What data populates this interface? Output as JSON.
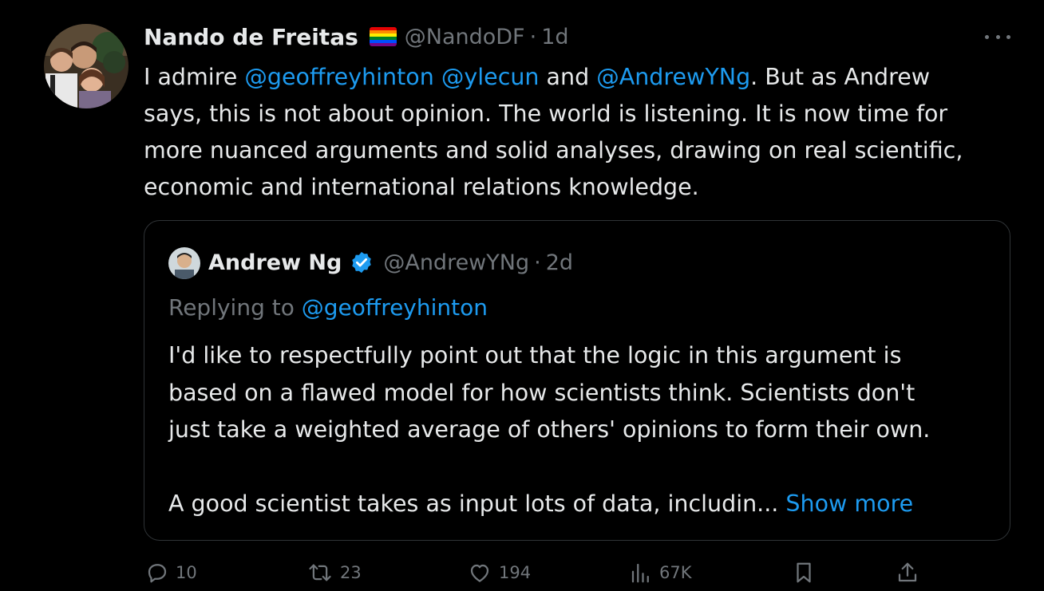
{
  "tweet": {
    "display_name": "Nando de Freitas",
    "handle": "@NandoDF",
    "separator": "·",
    "time": "1d",
    "flag_icon": "rainbow-flag-icon",
    "text_lines": [
      {
        "parts": [
          {
            "text": "I admire ",
            "mention": false
          },
          {
            "text": "@geoffreyhinton",
            "mention": true
          },
          {
            "text": " ",
            "mention": false
          },
          {
            "text": "@ylecun",
            "mention": true
          },
          {
            "text": " and ",
            "mention": false
          },
          {
            "text": "@AndrewYNg",
            "mention": true
          },
          {
            "text": ". But as Andrew",
            "mention": false
          }
        ]
      },
      {
        "parts": [
          {
            "text": "says, this is not about opinion. The world is listening. It is now time for",
            "mention": false
          }
        ]
      },
      {
        "parts": [
          {
            "text": "more nuanced arguments and solid analyses, drawing on real scientific,",
            "mention": false
          }
        ]
      },
      {
        "parts": [
          {
            "text": "economic and international relations knowledge.",
            "mention": false
          }
        ]
      }
    ]
  },
  "quote": {
    "display_name": "Andrew Ng",
    "handle": "@AndrewYNg",
    "separator": "·",
    "time": "2d",
    "replying_label": "Replying to ",
    "replying_handle": "@geoffreyhinton",
    "text_lines": [
      "I'd like to respectfully point out that the logic in this argument is",
      "based on a flawed model for how scientists think. Scientists don't",
      "just take a weighted average of others' opinions to form their own."
    ],
    "last_line": "A good scientist takes as input lots of data, includin...",
    "show_more": "Show more"
  },
  "actions": {
    "replies": "10",
    "reposts": "23",
    "likes": "194",
    "views": "67K"
  },
  "colors": {
    "background": "#000000",
    "text": "#e7e9ea",
    "muted": "#71767b",
    "accent": "#1d9bf0",
    "border": "#2f3336"
  }
}
